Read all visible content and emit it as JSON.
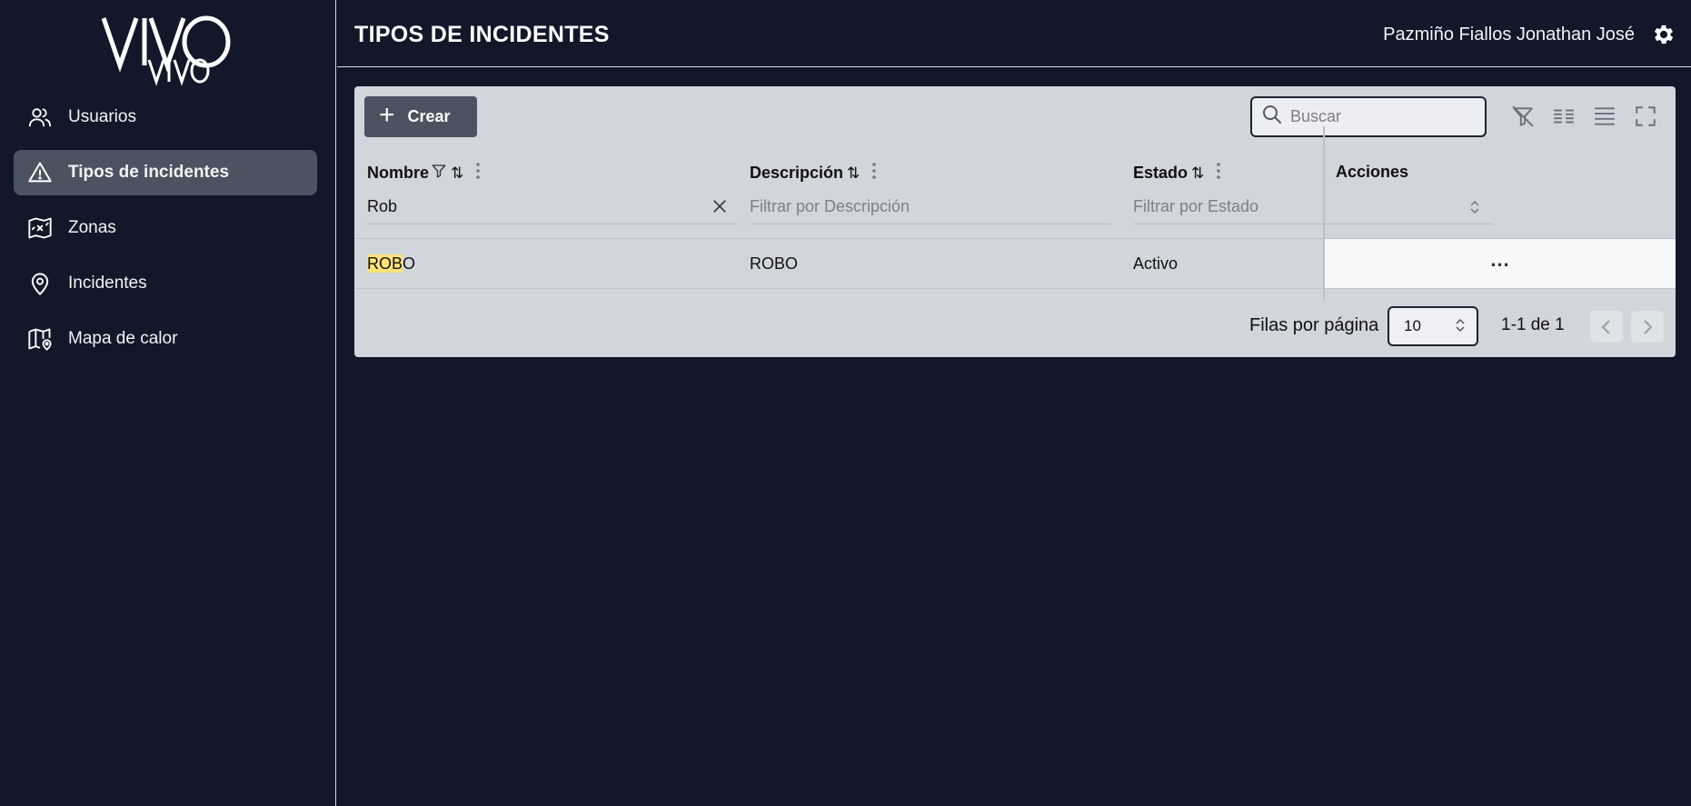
{
  "brand": {
    "logo_text": "VIVO"
  },
  "sidebar": {
    "items": [
      {
        "label": "Usuarios",
        "icon": "users-icon",
        "active": false
      },
      {
        "label": "Tipos de incidentes",
        "icon": "warning-triangle-icon",
        "active": true
      },
      {
        "label": "Zonas",
        "icon": "map-zone-icon",
        "active": false
      },
      {
        "label": "Incidentes",
        "icon": "location-pin-icon",
        "active": false
      },
      {
        "label": "Mapa de calor",
        "icon": "map-pin-icon",
        "active": false
      }
    ]
  },
  "header": {
    "title": "TIPOS DE INCIDENTES",
    "user_name": "Pazmiño Fiallos Jonathan José",
    "settings_icon": "gear-icon"
  },
  "toolbar": {
    "create_label": "Crear",
    "search_placeholder": "Buscar",
    "tools": [
      "clear-filters-icon",
      "columns-icon",
      "density-icon",
      "fullscreen-icon"
    ]
  },
  "table": {
    "columns": [
      {
        "label": "Nombre",
        "filter_value": "Rob",
        "filter_placeholder": ""
      },
      {
        "label": "Descripción",
        "filter_value": "",
        "filter_placeholder": "Filtrar por Descripción"
      },
      {
        "label": "Estado",
        "filter_value": "",
        "filter_placeholder": "Filtrar por Estado"
      }
    ],
    "actions_label": "Acciones",
    "rows": [
      {
        "nombre_match": "ROB",
        "nombre_rest": "O",
        "descripcion": "ROBO",
        "estado": "Activo"
      }
    ]
  },
  "pagination": {
    "rows_per_page_label": "Filas por página",
    "rows_per_page": "10",
    "range": "1-1 de 1"
  },
  "colors": {
    "background": "#121829",
    "active_nav": "#4b5361",
    "card": "#d1d5dc",
    "highlight": "#fde377"
  }
}
